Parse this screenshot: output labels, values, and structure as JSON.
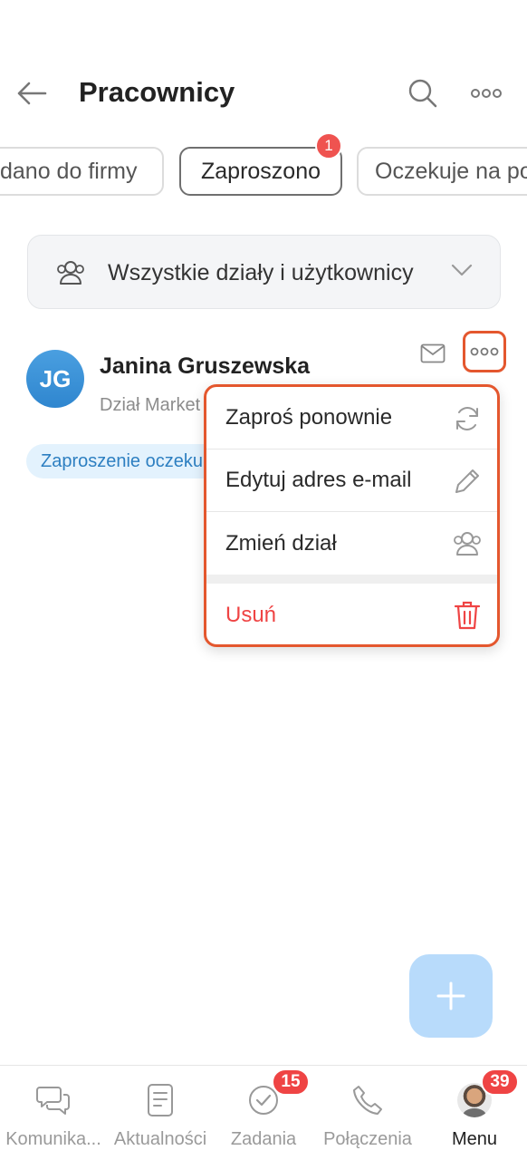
{
  "header": {
    "title": "Pracownicy"
  },
  "filters": {
    "chips": [
      {
        "label": "dano do firmy"
      },
      {
        "label": "Zaproszono",
        "badge": "1"
      },
      {
        "label": "Oczekuje na po"
      }
    ]
  },
  "department_selector": {
    "label": "Wszystkie działy i użytkownicy"
  },
  "employee": {
    "initials": "JG",
    "name": "Janina Gruszewska",
    "department": "Dział Market",
    "status": "Zaproszenie oczeku"
  },
  "context_menu": {
    "items": [
      {
        "label": "Zaproś ponownie",
        "icon": "refresh-icon"
      },
      {
        "label": "Edytuj adres e-mail",
        "icon": "pencil-icon"
      },
      {
        "label": "Zmień dział",
        "icon": "users-icon"
      },
      {
        "label": "Usuń",
        "icon": "trash-icon",
        "color": "#ef4444"
      }
    ]
  },
  "bottom_nav": {
    "items": [
      {
        "label": "Komunika...",
        "icon": "chat-icon"
      },
      {
        "label": "Aktualności",
        "icon": "news-icon"
      },
      {
        "label": "Zadania",
        "icon": "check-circle-icon",
        "badge": "15"
      },
      {
        "label": "Połączenia",
        "icon": "phone-icon"
      },
      {
        "label": "Menu",
        "icon": "avatar",
        "badge": "39",
        "active": true
      }
    ]
  },
  "colors": {
    "accent_highlight": "#e4572e",
    "badge_red": "#ef4444",
    "fab": "#b8dbfb",
    "avatar_blue": "#3a92d8"
  }
}
